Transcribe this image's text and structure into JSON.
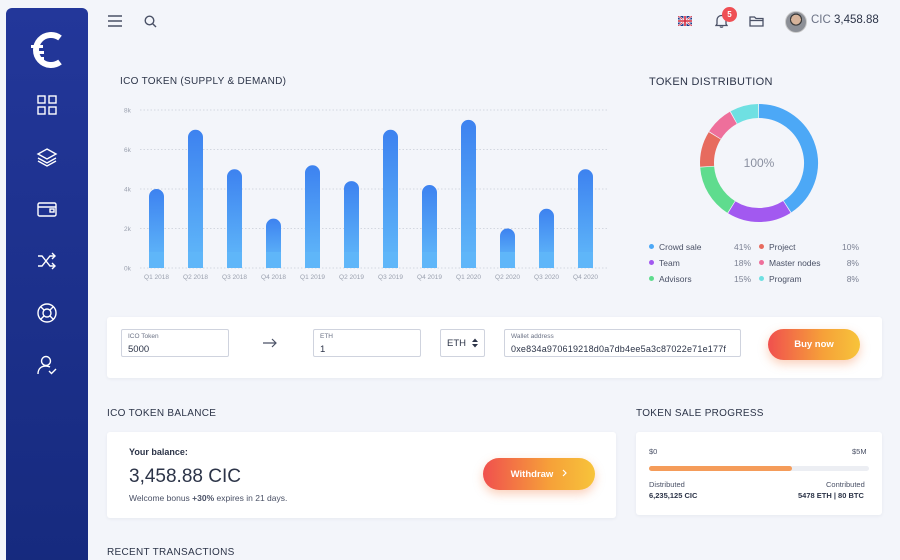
{
  "topbar": {
    "flag": "uk-flag-icon",
    "notifications_count": "5",
    "balance_currency": "CIC",
    "balance_value": "3,458.88"
  },
  "chart_section": {
    "title": "ICO TOKEN (SUPPLY & DEMAND)"
  },
  "chart_data": {
    "type": "bar",
    "title": "ICO TOKEN (SUPPLY & DEMAND)",
    "categories": [
      "Q1 2018",
      "Q2 2018",
      "Q3 2018",
      "Q4 2018",
      "Q1 2019",
      "Q2 2019",
      "Q3 2019",
      "Q4 2019",
      "Q1 2020",
      "Q2 2020",
      "Q3 2020",
      "Q4 2020"
    ],
    "values": [
      4000,
      7000,
      5000,
      2500,
      5200,
      4400,
      7000,
      4200,
      7500,
      2000,
      3000,
      5000
    ],
    "y_ticks": [
      "0k",
      "2k",
      "4k",
      "6k",
      "8k"
    ],
    "ylim": [
      0,
      8000
    ],
    "grid": true,
    "colors": {
      "bar_top": "#3d82f0",
      "bar_bottom": "#5fb6f9"
    }
  },
  "distribution": {
    "title": "TOKEN DISTRIBUTION",
    "center_label": "100%",
    "items": [
      {
        "name": "Crowd sale",
        "pct": "41%",
        "value": 41,
        "color": "#4ca8f6"
      },
      {
        "name": "Team",
        "pct": "18%",
        "value": 18,
        "color": "#a259f0"
      },
      {
        "name": "Advisors",
        "pct": "15%",
        "value": 15,
        "color": "#5fdc8e"
      },
      {
        "name": "Project",
        "pct": "10%",
        "value": 10,
        "color": "#e76b5e"
      },
      {
        "name": "Master nodes",
        "pct": "8%",
        "value": 8,
        "color": "#ee6f9b"
      },
      {
        "name": "Program",
        "pct": "8%",
        "value": 8,
        "color": "#6fe0e2"
      }
    ]
  },
  "buy": {
    "ico_label": "ICO Token",
    "ico_value": "5000",
    "eth_label": "ETH",
    "eth_value": "1",
    "currency_select": "ETH",
    "wallet_label": "Wallet address",
    "wallet_value": "0xe834a970619218d0a7db4ee5a3c87022e71e177f",
    "button": "Buy now"
  },
  "balance": {
    "section_title": "ICO TOKEN BALANCE",
    "label": "Your balance:",
    "amount": "3,458.88 CIC",
    "note_prefix": "Welcome bonus ",
    "note_bonus": "+30%",
    "note_suffix": " expires in 21 days.",
    "withdraw": "Withdraw"
  },
  "progress": {
    "section_title": "TOKEN SALE PROGRESS",
    "min": "$0",
    "max": "$5M",
    "fill_fraction": 0.65,
    "distributed_label": "Distributed",
    "distributed_value": "6,235,125 CIC",
    "contributed_label": "Contributed",
    "contributed_value": "5478 ETH | 80 BTC"
  },
  "transactions": {
    "title": "RECENT TRANSACTIONS"
  }
}
